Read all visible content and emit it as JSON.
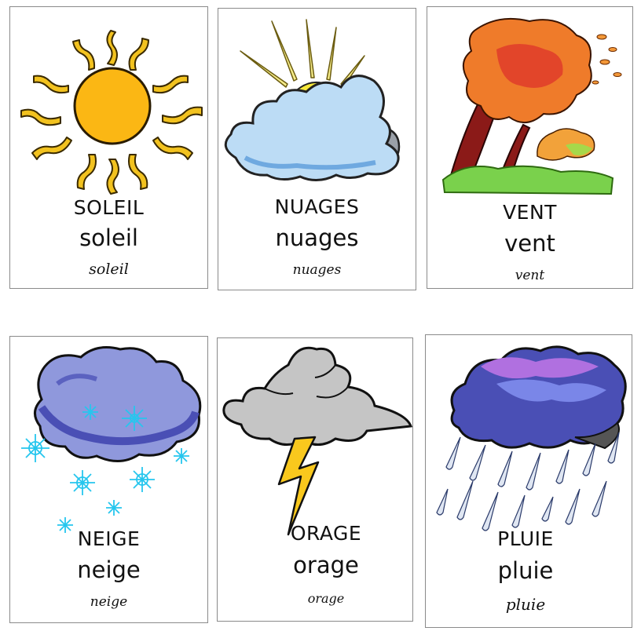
{
  "cards": [
    {
      "id": "soleil",
      "upper": "SOLEIL",
      "lower": "soleil",
      "cursive": "soleil",
      "icon": "sun-icon"
    },
    {
      "id": "nuages",
      "upper": "NUAGES",
      "lower": "nuages",
      "cursive": "nuages",
      "icon": "cloud-sun-icon"
    },
    {
      "id": "vent",
      "upper": "VENT",
      "lower": "vent",
      "cursive": "vent",
      "icon": "wind-tree-icon"
    },
    {
      "id": "neige",
      "upper": "NEIGE",
      "lower": "neige",
      "cursive": "neige",
      "icon": "snow-cloud-icon"
    },
    {
      "id": "orage",
      "upper": "ORAGE",
      "lower": "orage",
      "cursive": "orage",
      "icon": "lightning-cloud-icon"
    },
    {
      "id": "pluie",
      "upper": "PLUIE",
      "lower": "pluie",
      "cursive": "pluie",
      "icon": "rain-cloud-icon"
    }
  ],
  "colors": {
    "sun": "#fbb714",
    "sun_ray": "#f2c21f",
    "cloud_light": "#bcdcf5",
    "cloud_blue": "#8f98dc",
    "leaves": "#ec6b24",
    "grass": "#7ad14c",
    "lightning": "#f9c81d",
    "rain_cloud": "#4a4fb5",
    "rain_top": "#b070e0"
  }
}
